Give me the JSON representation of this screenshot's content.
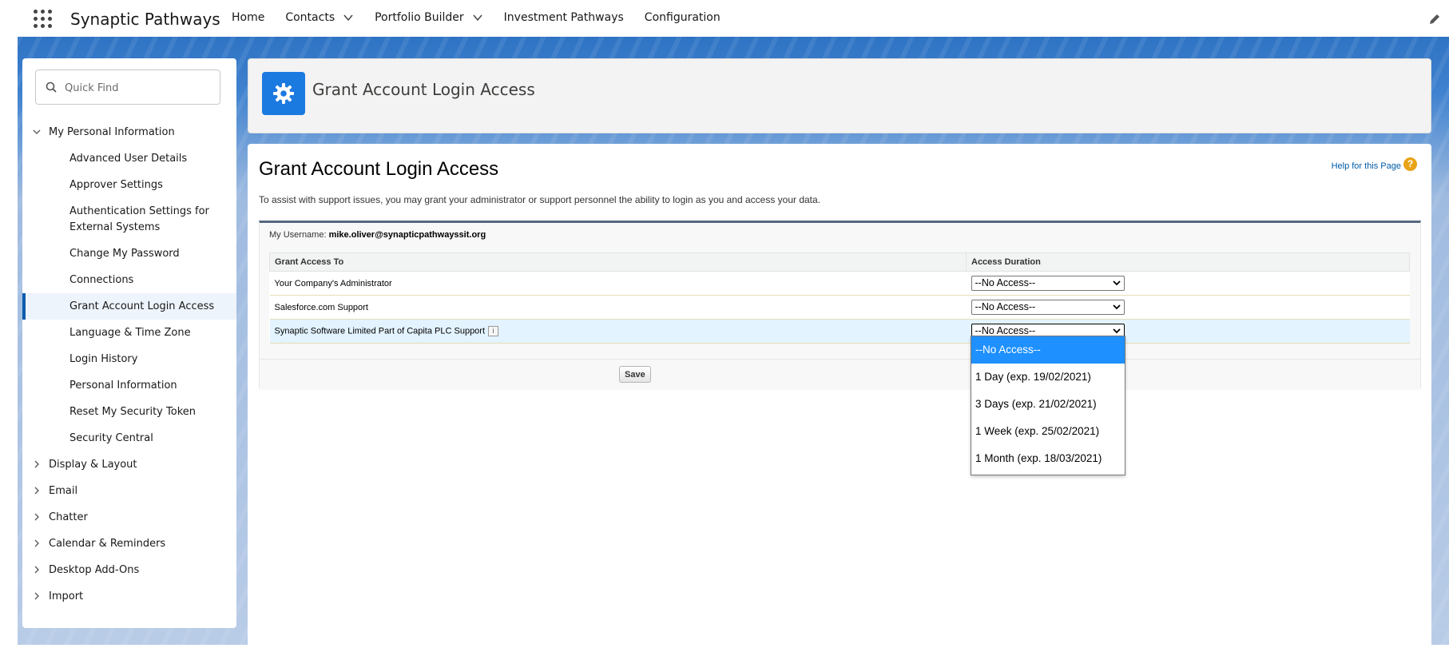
{
  "app": {
    "name": "Synaptic Pathways",
    "nav": [
      {
        "label": "Home",
        "has_menu": false
      },
      {
        "label": "Contacts",
        "has_menu": true
      },
      {
        "label": "Portfolio Builder",
        "has_menu": true
      },
      {
        "label": "Investment Pathways",
        "has_menu": false
      },
      {
        "label": "Configuration",
        "has_menu": false
      }
    ]
  },
  "sidebar": {
    "quick_find_placeholder": "Quick Find",
    "group_personal": "My Personal Information",
    "items": [
      "Advanced User Details",
      "Approver Settings",
      "Authentication Settings for External Systems",
      "Change My Password",
      "Connections",
      "Grant Account Login Access",
      "Language & Time Zone",
      "Login History",
      "Personal Information",
      "Reset My Security Token",
      "Security Central"
    ],
    "active_item": "Grant Account Login Access",
    "collapsed_groups": [
      "Display & Layout",
      "Email",
      "Chatter",
      "Calendar & Reminders",
      "Desktop Add-Ons",
      "Import"
    ]
  },
  "header": {
    "title": "Grant Account Login Access"
  },
  "main": {
    "title": "Grant Account Login Access",
    "help_link": "Help for this Page",
    "help_icon": "?",
    "description": "To assist with support issues, you may grant your administrator or support personnel the ability to login as you and access your data.",
    "username_label": "My Username:",
    "username": "mike.oliver@synapticpathwayssit.org",
    "columns": [
      "Grant Access To",
      "Access Duration"
    ],
    "rows": [
      {
        "grantee": "Your Company's Administrator",
        "duration": "--No Access--"
      },
      {
        "grantee": "Salesforce.com Support",
        "duration": "--No Access--"
      },
      {
        "grantee": "Synaptic Software Limited Part of Capita PLC Support",
        "duration": "--No Access--",
        "has_info": true
      }
    ],
    "save_label": "Save"
  },
  "dropdown": {
    "options": [
      "--No Access--",
      "1 Day (exp. 19/02/2021)",
      "3 Days (exp. 21/02/2021)",
      "1 Week (exp. 25/02/2021)",
      "1 Month (exp. 18/03/2021)"
    ],
    "selected": "--No Access--"
  },
  "colors": {
    "brand_blue": "#1b7ae0",
    "active_bar": "#0b5cab",
    "selected_option": "#1e90ff",
    "help_link": "#015ba7"
  }
}
